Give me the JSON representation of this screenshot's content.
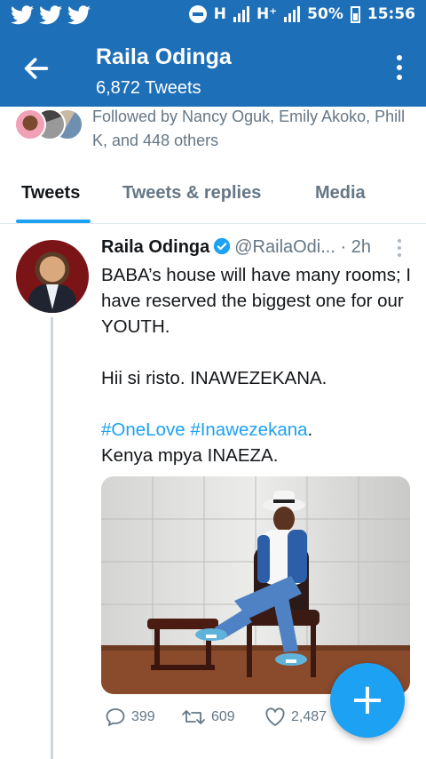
{
  "status_bar": {
    "network_1": "H",
    "network_2": "H⁺",
    "battery": "50%",
    "time": "15:56",
    "color": "#1d6fb8"
  },
  "header": {
    "back_icon": "arrow-left-icon",
    "title": "Raila Odinga",
    "subtitle": "6,872 Tweets",
    "more_icon": "vertical-dots-icon"
  },
  "followed_by": {
    "text": "Followed by Nancy Oguk, Emily Akoko, Phill K, and 448 others"
  },
  "tabs": [
    {
      "label": "Tweets",
      "active": true
    },
    {
      "label": "Tweets & replies",
      "active": false
    },
    {
      "label": "Media",
      "active": false
    }
  ],
  "tweet": {
    "author_name": "Raila Odinga",
    "handle": "@RailaOdi...",
    "separator": "·",
    "time": "2h",
    "lines": [
      "BABA’s house will have many rooms; I have reserved the biggest one for our YOUTH.",
      "Hii si risto. INAWEZEKANA."
    ],
    "hashtag_1": "#OneLove",
    "hashtag_2": "#Inawezekana",
    "after_hashtags": ".",
    "last_line": "Kenya mpya INAEZA.",
    "actions": {
      "reply_count": "399",
      "retweet_count": "609",
      "like_count": "2,487"
    }
  },
  "fab": {
    "label": "+",
    "color": "#1da1f2"
  },
  "colors": {
    "accent": "#1da1f2",
    "header": "#1d6fb8",
    "secondary_text": "#657786"
  }
}
